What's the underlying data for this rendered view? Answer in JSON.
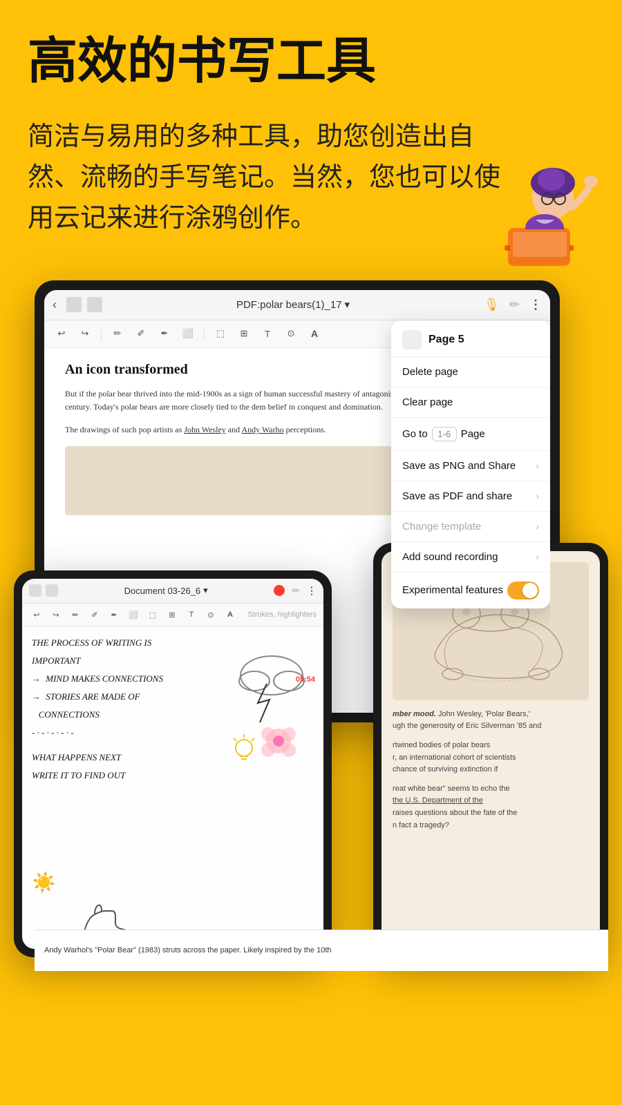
{
  "header": {
    "title": "高效的书写工具",
    "subtitle": "简洁与易用的多种工具，助您创造出自然、流畅的手写笔记。当然，您也可以使用云记来进行涂鸦创作。"
  },
  "ipad_main": {
    "topbar": {
      "title": "PDF:polar bears(1)_17",
      "dropdown_arrow": "▾"
    },
    "toolbar": {
      "undo": "↩",
      "redo": "↪",
      "pen": "✏",
      "pencil": "✐",
      "marker": "✒",
      "eraser": "⬜",
      "select": "⬚",
      "image": "⊞",
      "text": "T",
      "lasso": "⊙",
      "font": "A"
    },
    "pdf_content": {
      "article_title": "An icon transformed",
      "paragraph1": "But if the polar bear thrived into the mid-1900s as a sign of human successful mastery of antagonistic forces, this symbolic associatic 20th century. Today's polar bears are more closely tied to the dem belief in conquest and domination.",
      "paragraph2": "The drawings of such pop artists as John Wesley and Andy Warho perceptions."
    }
  },
  "context_menu": {
    "header": "Page 5",
    "items": [
      {
        "label": "Delete page",
        "type": "action",
        "disabled": false
      },
      {
        "label": "Clear page",
        "type": "action",
        "disabled": false
      },
      {
        "label": "Go to",
        "type": "goto",
        "input_placeholder": "1-6",
        "suffix": "Page"
      },
      {
        "label": "Save as PNG and Share",
        "type": "chevron",
        "disabled": false
      },
      {
        "label": "Save as PDF and share",
        "type": "chevron",
        "disabled": false
      },
      {
        "label": "Change template",
        "type": "chevron",
        "disabled": true
      },
      {
        "label": "Add sound recording",
        "type": "chevron",
        "disabled": false
      },
      {
        "label": "Experimental features",
        "type": "toggle",
        "enabled": true
      }
    ]
  },
  "ipad_second": {
    "topbar": {
      "title": "Document 03-26_6",
      "dropdown_arrow": "▾"
    },
    "strokes_label": "Strokes, highlighters",
    "time_badge": "05:54",
    "handwriting": [
      "THE PROCESS OF WRITING IS",
      "IMPORTANT",
      "→ MIND MAKES CONNECTIONS",
      "→ STORIES ARE MADE OF",
      "   CONNECTIONS",
      "- · - · - · - · -",
      "WHAT HAPPENS NEXT",
      "WRITE IT TO FIND OUT"
    ]
  },
  "ipad_third": {
    "text_blocks": [
      "mber mood. John Wesley, 'Polar Bears,' ugh the generosity of Eric Silverman '85 and",
      "rtwined bodies of polar bears r, an international cohort of scientists chance of surviving extinction if",
      "reat white bear\" seems to echo the he U.S. Department of the raises questions about the fate of the n fact a tragedy?"
    ],
    "bottom_text": "Andy Warhol's \"Polar Bear\" (1983) struts across the paper. Likely inspired by the 10th"
  },
  "department_text": "Department of the"
}
